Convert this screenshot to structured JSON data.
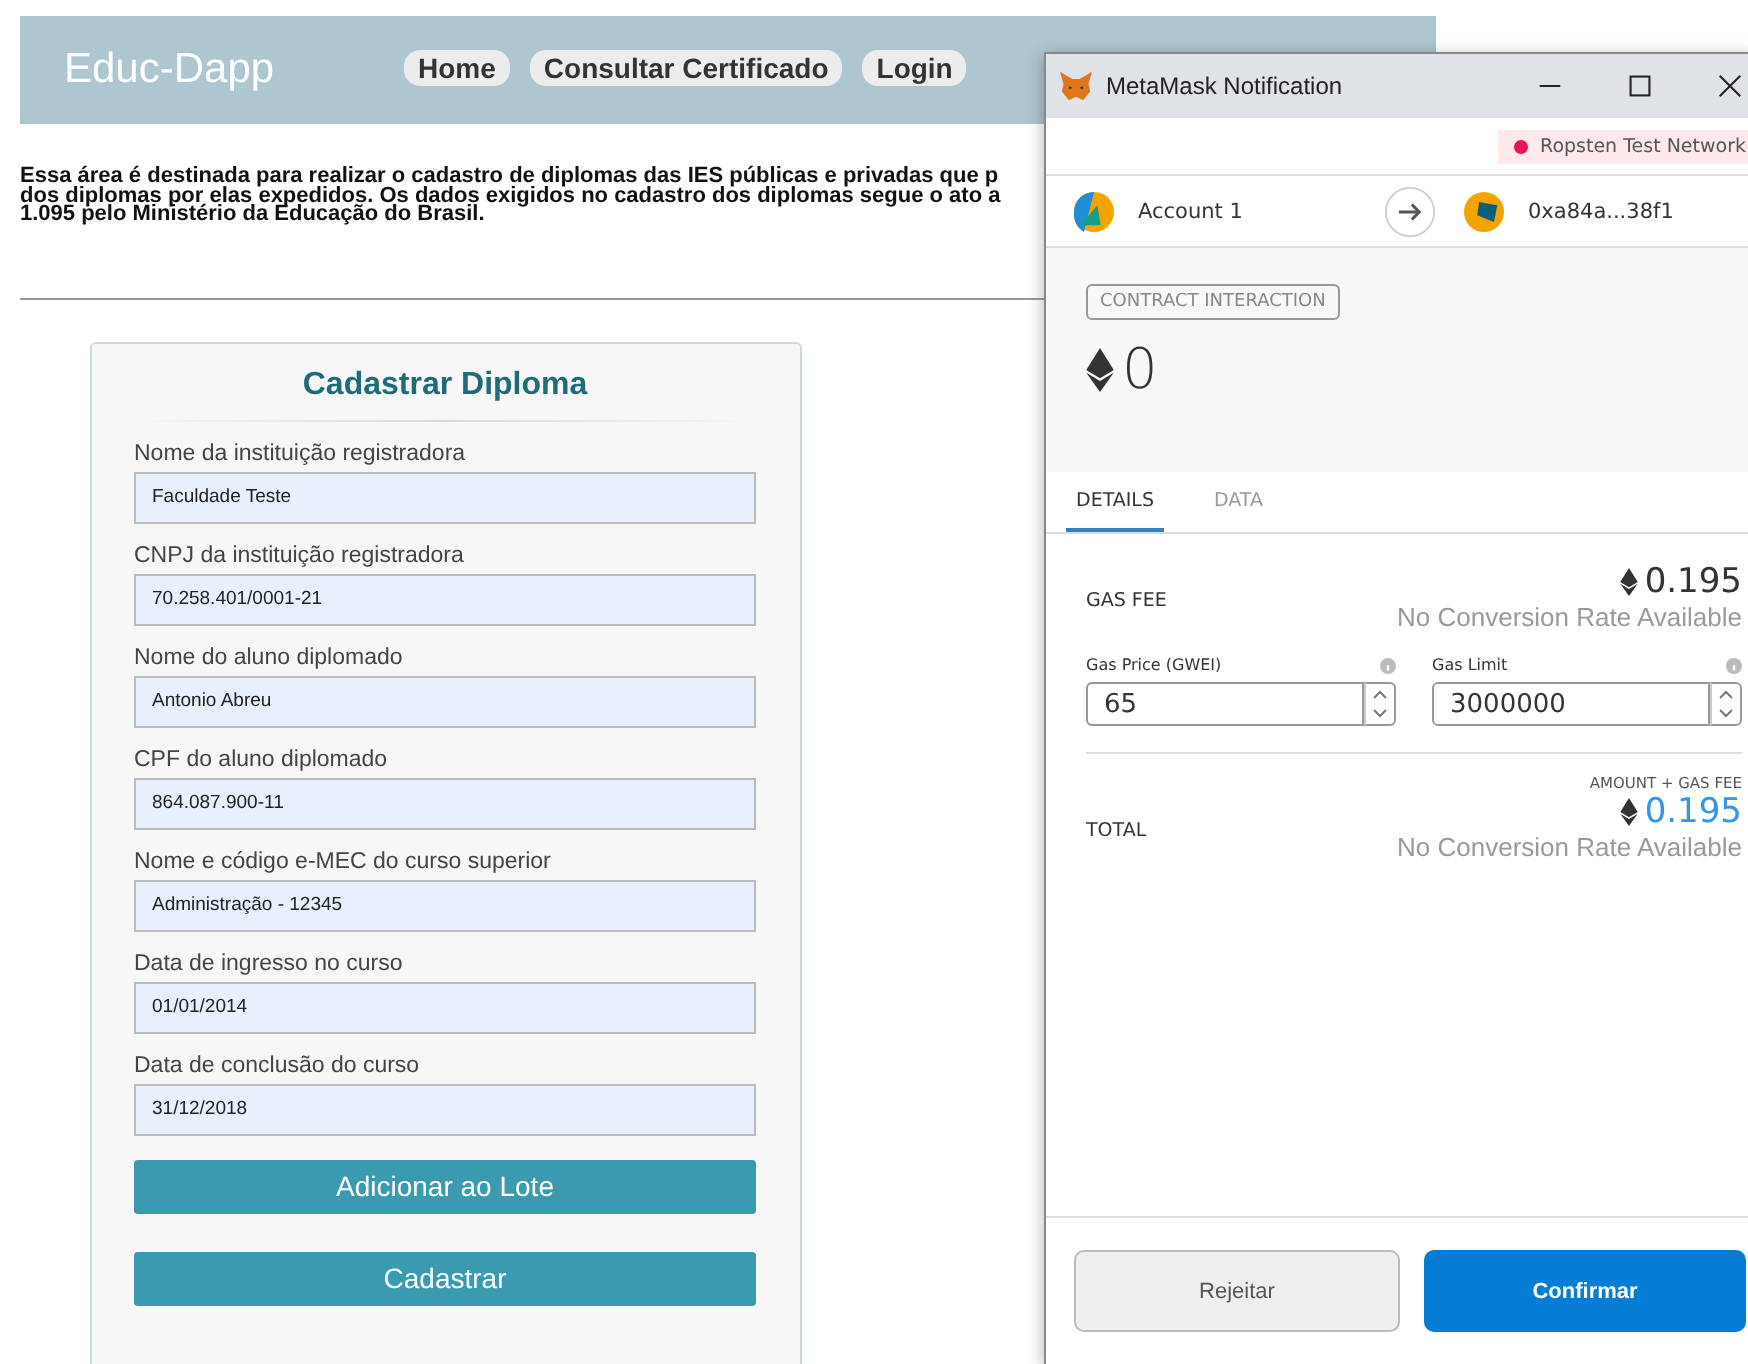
{
  "header": {
    "brand": "Educ-Dapp",
    "nav": [
      "Home",
      "Consultar Certificado",
      "Login"
    ]
  },
  "intro": [
    "Essa área é destinada para realizar o cadastro de diplomas das IES públicas e privadas que p",
    "dos diplomas por elas expedidos. Os dados exigidos no cadastro dos diplomas segue o ato a",
    "1.095 pelo Ministério da Educação do Brasil."
  ],
  "form": {
    "title": "Cadastrar Diploma",
    "fields": [
      {
        "label": "Nome da instituição registradora",
        "value": "Faculdade Teste"
      },
      {
        "label": "CNPJ da instituição registradora",
        "value": "70.258.401/0001-21"
      },
      {
        "label": "Nome do aluno diplomado",
        "value": "Antonio Abreu"
      },
      {
        "label": "CPF do aluno diplomado",
        "value": "864.087.900-11"
      },
      {
        "label": "Nome e código e-MEC do curso superior",
        "value": "Administração - 12345"
      },
      {
        "label": "Data de ingresso no curso",
        "value": "01/01/2014"
      },
      {
        "label": "Data de conclusão do curso",
        "value": "31/12/2018"
      }
    ],
    "buttons": [
      "Adicionar ao Lote",
      "Cadastrar"
    ]
  },
  "metamask": {
    "title": "MetaMask Notification",
    "network": "Ropsten Test Network",
    "from": "Account 1",
    "to": "0xa84a...38f1",
    "badge": "CONTRACT INTERACTION",
    "amount": "0",
    "tabs": [
      {
        "label": "DETAILS",
        "selected": true
      },
      {
        "label": "DATA",
        "selected": false
      }
    ],
    "gas_fee": {
      "label": "GAS FEE",
      "value": "0.195",
      "conversion": "No Conversion Rate Available"
    },
    "gas_price": {
      "label": "Gas Price (GWEI)",
      "value": "65"
    },
    "gas_limit": {
      "label": "Gas Limit",
      "value": "3000000"
    },
    "total": {
      "caption": "AMOUNT + GAS FEE",
      "label": "TOTAL",
      "value": "0.195",
      "conversion": "No Conversion Rate Available"
    },
    "buttons": {
      "reject": "Rejeitar",
      "confirm": "Confirmar"
    }
  }
}
